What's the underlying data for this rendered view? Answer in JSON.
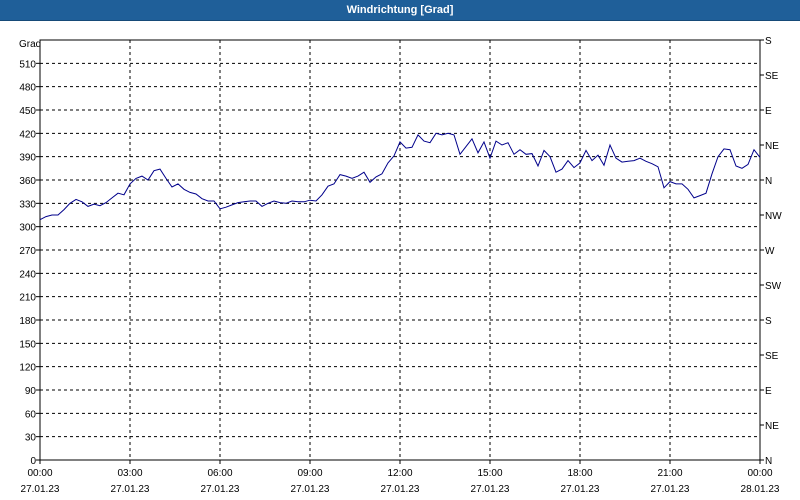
{
  "window": {
    "title": "Windrichtung [Grad]"
  },
  "chart_data": {
    "type": "line",
    "title": "Windrichtung [Grad]",
    "ylabel": "Grad",
    "ylim": [
      0,
      540
    ],
    "yticks": [
      0,
      30,
      60,
      90,
      120,
      150,
      180,
      210,
      240,
      270,
      300,
      330,
      360,
      390,
      420,
      450,
      480,
      510
    ],
    "right_axis": {
      "ticks": [
        0,
        45,
        90,
        135,
        180,
        225,
        270,
        315,
        360,
        405,
        450,
        495,
        540
      ],
      "labels": [
        "N",
        "NE",
        "E",
        "SE",
        "S",
        "SW",
        "W",
        "NW",
        "N",
        "NE",
        "E",
        "SE",
        "S"
      ]
    },
    "xlim_hours": [
      0,
      24
    ],
    "xticks": [
      {
        "hour": 0,
        "time": "00:00",
        "date": "27.01.23"
      },
      {
        "hour": 3,
        "time": "03:00",
        "date": "27.01.23"
      },
      {
        "hour": 6,
        "time": "06:00",
        "date": "27.01.23"
      },
      {
        "hour": 9,
        "time": "09:00",
        "date": "27.01.23"
      },
      {
        "hour": 12,
        "time": "12:00",
        "date": "27.01.23"
      },
      {
        "hour": 15,
        "time": "15:00",
        "date": "27.01.23"
      },
      {
        "hour": 18,
        "time": "18:00",
        "date": "27.01.23"
      },
      {
        "hour": 21,
        "time": "21:00",
        "date": "27.01.23"
      },
      {
        "hour": 24,
        "time": "00:00",
        "date": "28.01.23"
      }
    ],
    "grid": true,
    "line_color": "#00008b",
    "series": [
      {
        "x": [
          0.0,
          0.2,
          0.4,
          0.6,
          0.8,
          1.0,
          1.2,
          1.4,
          1.6,
          1.8,
          2.0,
          2.2,
          2.4,
          2.6,
          2.8,
          3.0,
          3.2,
          3.4,
          3.6,
          3.8,
          4.0,
          4.2,
          4.4,
          4.6,
          4.8,
          5.0,
          5.2,
          5.4,
          5.6,
          5.8,
          6.0,
          6.2,
          6.4,
          6.6,
          6.8,
          7.0,
          7.2,
          7.4,
          7.6,
          7.8,
          8.0,
          8.2,
          8.4,
          8.6,
          8.8,
          9.0,
          9.2,
          9.4,
          9.6,
          9.8,
          10.0,
          10.2,
          10.4,
          10.6,
          10.8,
          11.0,
          11.2,
          11.4,
          11.6,
          11.8,
          12.0,
          12.2,
          12.4,
          12.6,
          12.8,
          13.0,
          13.2,
          13.4,
          13.6,
          13.8,
          14.0,
          14.2,
          14.4,
          14.6,
          14.8,
          15.0,
          15.2,
          15.4,
          15.6,
          15.8,
          16.0,
          16.2,
          16.4,
          16.6,
          16.8,
          17.0,
          17.2,
          17.4,
          17.6,
          17.8,
          18.0,
          18.2,
          18.4,
          18.6,
          18.8,
          19.0,
          19.2,
          19.4,
          19.6,
          19.8,
          20.0,
          20.2,
          20.4,
          20.6,
          20.8,
          21.0,
          21.2,
          21.4,
          21.6,
          21.8,
          22.0,
          22.2,
          22.4,
          22.6,
          22.8,
          23.0,
          23.2,
          23.4,
          23.6,
          23.8,
          24.0
        ],
        "values": [
          309,
          313,
          315,
          315,
          322,
          330,
          335,
          332,
          326,
          329,
          327,
          331,
          337,
          343,
          341,
          355,
          362,
          365,
          360,
          372,
          374,
          362,
          351,
          355,
          348,
          344,
          342,
          336,
          333,
          333,
          323,
          325,
          328,
          331,
          332,
          333,
          333,
          326,
          330,
          333,
          331,
          330,
          333,
          332,
          332,
          334,
          333,
          341,
          352,
          355,
          367,
          365,
          362,
          365,
          370,
          357,
          364,
          368,
          382,
          391,
          409,
          401,
          402,
          418,
          410,
          408,
          420,
          418,
          420,
          418,
          393,
          403,
          413,
          395,
          409,
          388,
          410,
          405,
          408,
          393,
          399,
          393,
          394,
          378,
          398,
          390,
          370,
          374,
          385,
          376,
          382,
          398,
          385,
          392,
          379,
          405,
          388,
          383,
          384,
          385,
          388,
          384,
          381,
          377,
          350,
          358,
          355,
          355,
          348,
          337,
          340,
          343,
          368,
          390,
          400,
          399,
          378,
          375,
          380,
          399,
          389
        ]
      }
    ]
  }
}
